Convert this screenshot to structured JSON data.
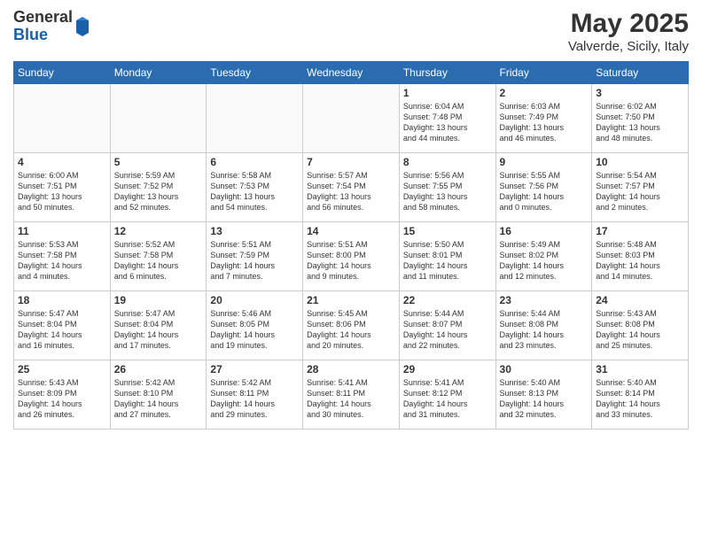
{
  "header": {
    "logo_general": "General",
    "logo_blue": "Blue",
    "month_title": "May 2025",
    "location": "Valverde, Sicily, Italy"
  },
  "weekdays": [
    "Sunday",
    "Monday",
    "Tuesday",
    "Wednesday",
    "Thursday",
    "Friday",
    "Saturday"
  ],
  "weeks": [
    [
      {
        "day": "",
        "info": ""
      },
      {
        "day": "",
        "info": ""
      },
      {
        "day": "",
        "info": ""
      },
      {
        "day": "",
        "info": ""
      },
      {
        "day": "1",
        "info": "Sunrise: 6:04 AM\nSunset: 7:48 PM\nDaylight: 13 hours\nand 44 minutes."
      },
      {
        "day": "2",
        "info": "Sunrise: 6:03 AM\nSunset: 7:49 PM\nDaylight: 13 hours\nand 46 minutes."
      },
      {
        "day": "3",
        "info": "Sunrise: 6:02 AM\nSunset: 7:50 PM\nDaylight: 13 hours\nand 48 minutes."
      }
    ],
    [
      {
        "day": "4",
        "info": "Sunrise: 6:00 AM\nSunset: 7:51 PM\nDaylight: 13 hours\nand 50 minutes."
      },
      {
        "day": "5",
        "info": "Sunrise: 5:59 AM\nSunset: 7:52 PM\nDaylight: 13 hours\nand 52 minutes."
      },
      {
        "day": "6",
        "info": "Sunrise: 5:58 AM\nSunset: 7:53 PM\nDaylight: 13 hours\nand 54 minutes."
      },
      {
        "day": "7",
        "info": "Sunrise: 5:57 AM\nSunset: 7:54 PM\nDaylight: 13 hours\nand 56 minutes."
      },
      {
        "day": "8",
        "info": "Sunrise: 5:56 AM\nSunset: 7:55 PM\nDaylight: 13 hours\nand 58 minutes."
      },
      {
        "day": "9",
        "info": "Sunrise: 5:55 AM\nSunset: 7:56 PM\nDaylight: 14 hours\nand 0 minutes."
      },
      {
        "day": "10",
        "info": "Sunrise: 5:54 AM\nSunset: 7:57 PM\nDaylight: 14 hours\nand 2 minutes."
      }
    ],
    [
      {
        "day": "11",
        "info": "Sunrise: 5:53 AM\nSunset: 7:58 PM\nDaylight: 14 hours\nand 4 minutes."
      },
      {
        "day": "12",
        "info": "Sunrise: 5:52 AM\nSunset: 7:58 PM\nDaylight: 14 hours\nand 6 minutes."
      },
      {
        "day": "13",
        "info": "Sunrise: 5:51 AM\nSunset: 7:59 PM\nDaylight: 14 hours\nand 7 minutes."
      },
      {
        "day": "14",
        "info": "Sunrise: 5:51 AM\nSunset: 8:00 PM\nDaylight: 14 hours\nand 9 minutes."
      },
      {
        "day": "15",
        "info": "Sunrise: 5:50 AM\nSunset: 8:01 PM\nDaylight: 14 hours\nand 11 minutes."
      },
      {
        "day": "16",
        "info": "Sunrise: 5:49 AM\nSunset: 8:02 PM\nDaylight: 14 hours\nand 12 minutes."
      },
      {
        "day": "17",
        "info": "Sunrise: 5:48 AM\nSunset: 8:03 PM\nDaylight: 14 hours\nand 14 minutes."
      }
    ],
    [
      {
        "day": "18",
        "info": "Sunrise: 5:47 AM\nSunset: 8:04 PM\nDaylight: 14 hours\nand 16 minutes."
      },
      {
        "day": "19",
        "info": "Sunrise: 5:47 AM\nSunset: 8:04 PM\nDaylight: 14 hours\nand 17 minutes."
      },
      {
        "day": "20",
        "info": "Sunrise: 5:46 AM\nSunset: 8:05 PM\nDaylight: 14 hours\nand 19 minutes."
      },
      {
        "day": "21",
        "info": "Sunrise: 5:45 AM\nSunset: 8:06 PM\nDaylight: 14 hours\nand 20 minutes."
      },
      {
        "day": "22",
        "info": "Sunrise: 5:44 AM\nSunset: 8:07 PM\nDaylight: 14 hours\nand 22 minutes."
      },
      {
        "day": "23",
        "info": "Sunrise: 5:44 AM\nSunset: 8:08 PM\nDaylight: 14 hours\nand 23 minutes."
      },
      {
        "day": "24",
        "info": "Sunrise: 5:43 AM\nSunset: 8:08 PM\nDaylight: 14 hours\nand 25 minutes."
      }
    ],
    [
      {
        "day": "25",
        "info": "Sunrise: 5:43 AM\nSunset: 8:09 PM\nDaylight: 14 hours\nand 26 minutes."
      },
      {
        "day": "26",
        "info": "Sunrise: 5:42 AM\nSunset: 8:10 PM\nDaylight: 14 hours\nand 27 minutes."
      },
      {
        "day": "27",
        "info": "Sunrise: 5:42 AM\nSunset: 8:11 PM\nDaylight: 14 hours\nand 29 minutes."
      },
      {
        "day": "28",
        "info": "Sunrise: 5:41 AM\nSunset: 8:11 PM\nDaylight: 14 hours\nand 30 minutes."
      },
      {
        "day": "29",
        "info": "Sunrise: 5:41 AM\nSunset: 8:12 PM\nDaylight: 14 hours\nand 31 minutes."
      },
      {
        "day": "30",
        "info": "Sunrise: 5:40 AM\nSunset: 8:13 PM\nDaylight: 14 hours\nand 32 minutes."
      },
      {
        "day": "31",
        "info": "Sunrise: 5:40 AM\nSunset: 8:14 PM\nDaylight: 14 hours\nand 33 minutes."
      }
    ]
  ]
}
